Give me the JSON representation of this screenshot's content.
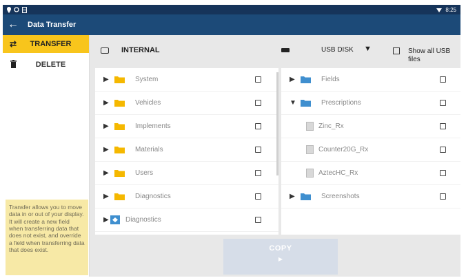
{
  "status_bar": {
    "left_icons": [
      "location-icon",
      "sync-icon",
      "tablet-icon"
    ],
    "time": "8:25"
  },
  "app_bar": {
    "title": "Data Transfer"
  },
  "sidebar": {
    "items": [
      {
        "label": "TRANSFER",
        "icon": "transfer-icon",
        "active": true
      },
      {
        "label": "DELETE",
        "icon": "trash-icon",
        "active": false
      }
    ],
    "info_text": "Transfer allows you to move data in or out of your display. It will create a new field when transferring data that does not exist, and override a field when transferring data that does exist."
  },
  "source": {
    "label": "INTERNAL"
  },
  "destination": {
    "label": "USB DISK",
    "show_all_label": "Show all USB files"
  },
  "left_list": [
    {
      "label": "System",
      "kind": "folder"
    },
    {
      "label": "Vehicles",
      "kind": "folder"
    },
    {
      "label": "Implements",
      "kind": "folder"
    },
    {
      "label": "Materials",
      "kind": "folder"
    },
    {
      "label": "Users",
      "kind": "folder"
    },
    {
      "label": "Diagnostics",
      "kind": "folder"
    },
    {
      "label": "Diagnostics",
      "kind": "app"
    }
  ],
  "right_list": [
    {
      "label": "Fields",
      "kind": "folder",
      "expanded": false
    },
    {
      "label": "Prescriptions",
      "kind": "folder",
      "expanded": true
    },
    {
      "label": "Zinc_Rx",
      "kind": "file"
    },
    {
      "label": "Counter20G_Rx",
      "kind": "file"
    },
    {
      "label": "AztecHC_Rx",
      "kind": "file"
    },
    {
      "label": "Screenshots",
      "kind": "folder",
      "expanded": false
    }
  ],
  "copy_button": {
    "label": "COPY"
  },
  "colors": {
    "status_bar": "#16345a",
    "app_bar": "#1c4a78",
    "accent_yellow": "#f8c51c",
    "folder_yellow": "#f5b800",
    "folder_blue": "#3f8fcf",
    "info_bg": "#f7e9a6",
    "copy_disabled": "#d6dde8"
  }
}
